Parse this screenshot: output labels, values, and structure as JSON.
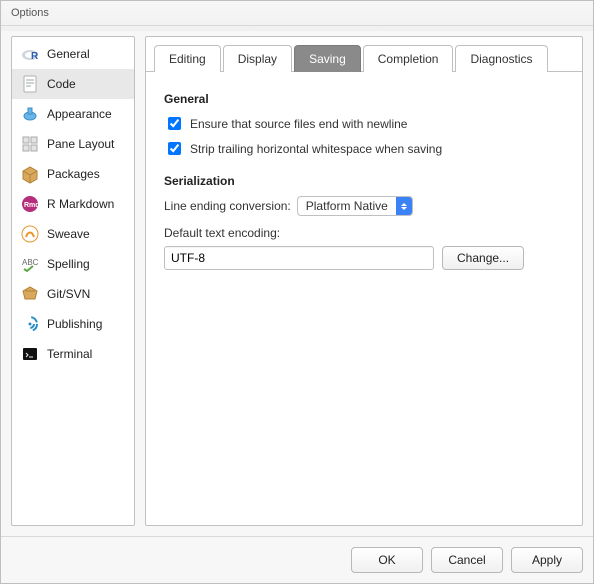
{
  "window": {
    "title": "Options"
  },
  "sidebar": {
    "items": [
      {
        "label": "General"
      },
      {
        "label": "Code"
      },
      {
        "label": "Appearance"
      },
      {
        "label": "Pane Layout"
      },
      {
        "label": "Packages"
      },
      {
        "label": "R Markdown"
      },
      {
        "label": "Sweave"
      },
      {
        "label": "Spelling"
      },
      {
        "label": "Git/SVN"
      },
      {
        "label": "Publishing"
      },
      {
        "label": "Terminal"
      }
    ],
    "selected_index": 1
  },
  "tabs": {
    "items": [
      {
        "label": "Editing"
      },
      {
        "label": "Display"
      },
      {
        "label": "Saving"
      },
      {
        "label": "Completion"
      },
      {
        "label": "Diagnostics"
      }
    ],
    "selected_index": 2
  },
  "panel": {
    "general": {
      "title": "General",
      "ensure_newline_label": "Ensure that source files end with newline",
      "ensure_newline_checked": true,
      "strip_whitespace_label": "Strip trailing horizontal whitespace when saving",
      "strip_whitespace_checked": true
    },
    "serialization": {
      "title": "Serialization",
      "line_ending_label": "Line ending conversion:",
      "line_ending_value": "Platform Native",
      "encoding_label": "Default text encoding:",
      "encoding_value": "UTF-8",
      "change_button": "Change..."
    }
  },
  "footer": {
    "ok": "OK",
    "cancel": "Cancel",
    "apply": "Apply"
  }
}
